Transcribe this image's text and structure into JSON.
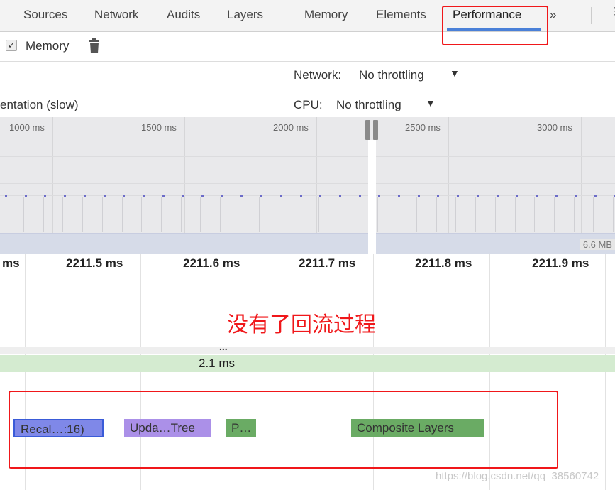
{
  "tabs": [
    {
      "label": "Sources"
    },
    {
      "label": "Network"
    },
    {
      "label": "Audits"
    },
    {
      "label": "Layers"
    },
    {
      "label": "Memory"
    },
    {
      "label": "Elements"
    },
    {
      "label": "Performance",
      "active": true
    }
  ],
  "tabs_more": "»",
  "toolbar": {
    "memory_label": "Memory",
    "memory_checked": true
  },
  "settings": {
    "network_label": "Network:",
    "network_value": "No throttling",
    "cpu_label": "CPU:",
    "cpu_value": "No throttling",
    "left_partial": "entation (slow)"
  },
  "overview": {
    "ticks": [
      "1000 ms",
      "1500 ms",
      "2000 ms",
      "2500 ms",
      "3000 ms"
    ],
    "memory_label": "6.6 MB"
  },
  "ruler": {
    "ticks": [
      "ms",
      "2211.5 ms",
      "2211.6 ms",
      "2211.7 ms",
      "2211.8 ms",
      "2211.9 ms"
    ]
  },
  "annotation": "没有了回流过程",
  "splitter": "...",
  "frame": {
    "duration": "2.1 ms"
  },
  "events": [
    {
      "label": "Recal…:16)",
      "color": "#7f88e8"
    },
    {
      "label": "Upda…Tree",
      "color": "#ab90e8"
    },
    {
      "label": "P…",
      "color": "#6aab64"
    },
    {
      "label": "Composite Layers",
      "color": "#6aab64"
    }
  ],
  "watermark": "https://blog.csdn.net/qq_38560742",
  "colors": {
    "highlight": "#f0171a",
    "accent": "#4a80d8"
  }
}
